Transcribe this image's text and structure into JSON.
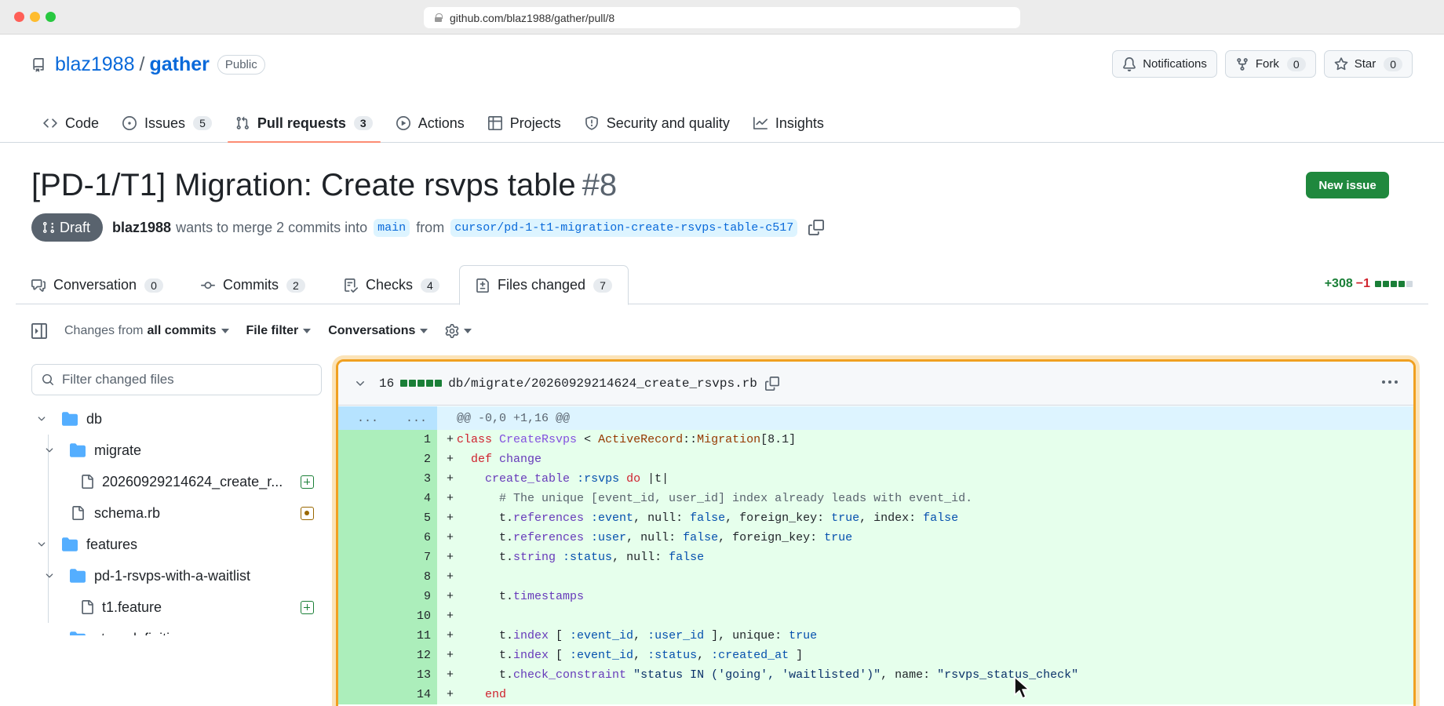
{
  "browser": {
    "url": "github.com/blaz1988/gather/pull/8"
  },
  "repo": {
    "owner": "blaz1988",
    "separator": "/",
    "name": "gather",
    "visibility": "Public",
    "notifications_label": "Notifications",
    "fork_label": "Fork",
    "fork_count": "0",
    "star_label": "Star",
    "star_count": "0"
  },
  "nav": {
    "code": "Code",
    "issues": "Issues",
    "issues_count": "5",
    "pulls": "Pull requests",
    "pulls_count": "3",
    "actions": "Actions",
    "projects": "Projects",
    "security": "Security and quality",
    "insights": "Insights"
  },
  "pr": {
    "title": "[PD-1/T1] Migration: Create rsvps table",
    "number": "#8",
    "new_issue": "New issue",
    "state": "Draft",
    "author": "blaz1988",
    "merge_text": "wants to merge 2 commits into",
    "base_branch": "main",
    "from_text": "from",
    "head_branch": "cursor/pd-1-t1-migration-create-rsvps-table-c517"
  },
  "tabs": {
    "conversation": "Conversation",
    "conversation_count": "0",
    "commits": "Commits",
    "commits_count": "2",
    "checks": "Checks",
    "checks_count": "4",
    "files": "Files changed",
    "files_count": "7",
    "additions": "+308",
    "deletions": "−1"
  },
  "toolbar": {
    "changes_prefix": "Changes from",
    "changes_value": "all commits",
    "file_filter": "File filter",
    "conversations": "Conversations"
  },
  "tree": {
    "filter_placeholder": "Filter changed files",
    "items": [
      {
        "label": "db"
      },
      {
        "label": "migrate"
      },
      {
        "label": "20260929214624_create_r..."
      },
      {
        "label": "schema.rb"
      },
      {
        "label": "features"
      },
      {
        "label": "pd-1-rsvps-with-a-waitlist"
      },
      {
        "label": "t1.feature"
      },
      {
        "label": "step_definitions"
      }
    ]
  },
  "diff": {
    "line_count": "16",
    "path": "db/migrate/20260929214624_create_rsvps.rb",
    "hunk_dots_left": "...",
    "hunk_dots_right": "...",
    "hunk_header": "@@ -0,0 +1,16 @@",
    "lines": [
      {
        "n": "1",
        "code": "class CreateRsvps < ActiveRecord::Migration[8.1]"
      },
      {
        "n": "2",
        "code": "  def change"
      },
      {
        "n": "3",
        "code": "    create_table :rsvps do |t|"
      },
      {
        "n": "4",
        "code": "      # The unique [event_id, user_id] index already leads with event_id."
      },
      {
        "n": "5",
        "code": "      t.references :event, null: false, foreign_key: true, index: false"
      },
      {
        "n": "6",
        "code": "      t.references :user, null: false, foreign_key: true"
      },
      {
        "n": "7",
        "code": "      t.string :status, null: false"
      },
      {
        "n": "8",
        "code": ""
      },
      {
        "n": "9",
        "code": "      t.timestamps"
      },
      {
        "n": "10",
        "code": ""
      },
      {
        "n": "11",
        "code": "      t.index [ :event_id, :user_id ], unique: true"
      },
      {
        "n": "12",
        "code": "      t.index [ :event_id, :status, :created_at ]"
      },
      {
        "n": "13",
        "code": "      t.check_constraint \"status IN ('going', 'waitlisted')\", name: \"rsvps_status_check\""
      },
      {
        "n": "14",
        "code": "    end"
      }
    ]
  },
  "colors": {
    "accent_green": "#1f883d",
    "diff_add_bg": "#e6ffec",
    "diff_add_gutter": "#aceebb",
    "focus_outline": "#f0a020",
    "tab_underline": "#fd8c73"
  }
}
